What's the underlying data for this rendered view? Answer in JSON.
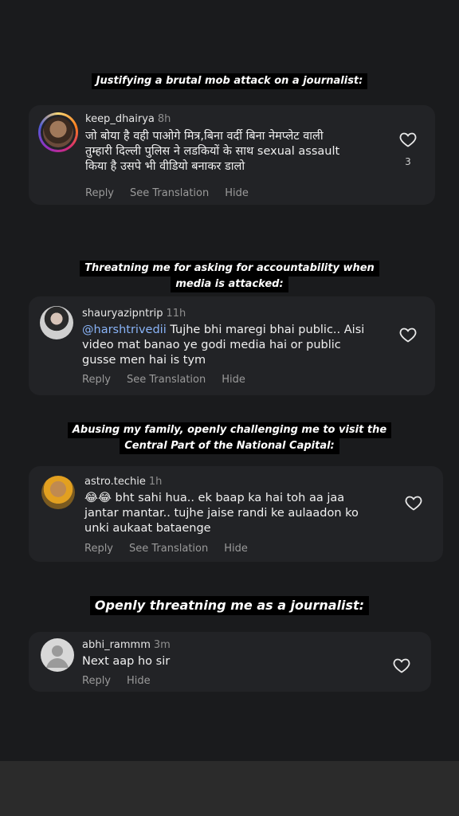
{
  "captions": [
    [
      "Justifying a brutal mob attack on a journalist:"
    ],
    [
      "Threatning me for asking for accountability when",
      "media is attacked:"
    ],
    [
      "Abusing my family, openly challenging me to visit the",
      "Central Part of the National Capital:"
    ],
    [
      "Openly threatning me as a journalist:"
    ]
  ],
  "comments": [
    {
      "username": "keep_dhairya",
      "time": "8h",
      "lines": [
        "जो बोया है वही पाओगे मित्र,बिना वर्दी बिना नेमप्लेट वाली",
        "तुम्हारी दिल्ली पुलिस ने लडकियों के साथ sexual assault",
        "किया है उसपे भी वीडियो बनाकर डालो"
      ],
      "actions": [
        "Reply",
        "See Translation",
        "Hide"
      ],
      "like_count": "3"
    },
    {
      "username": "shauryazipntrip",
      "time": "11h",
      "mention": "@harshtrivedii",
      "lines": [
        " Tujhe bhi maregi bhai public.. Aisi",
        "video mat banao ye godi media hai or public",
        "gusse men hai is tym"
      ],
      "actions": [
        "Reply",
        "See Translation",
        "Hide"
      ]
    },
    {
      "username": "astro.techie",
      "time": "1h",
      "lines": [
        "😂😂 bht sahi hua.. ek baap ka hai toh aa jaa",
        "jantar mantar.. tujhe jaise randi ke aulaadon ko",
        "unki aukaat bataenge"
      ],
      "actions": [
        "Reply",
        "See Translation",
        "Hide"
      ]
    },
    {
      "username": "abhi_rammm",
      "time": "3m",
      "lines": [
        "Next aap ho sir"
      ],
      "actions": [
        "Reply",
        "Hide"
      ]
    }
  ],
  "colors": {
    "background": "#1a1b1d",
    "card": "#222326",
    "mention": "#8ab4f8",
    "action": "#9a9a9a"
  }
}
